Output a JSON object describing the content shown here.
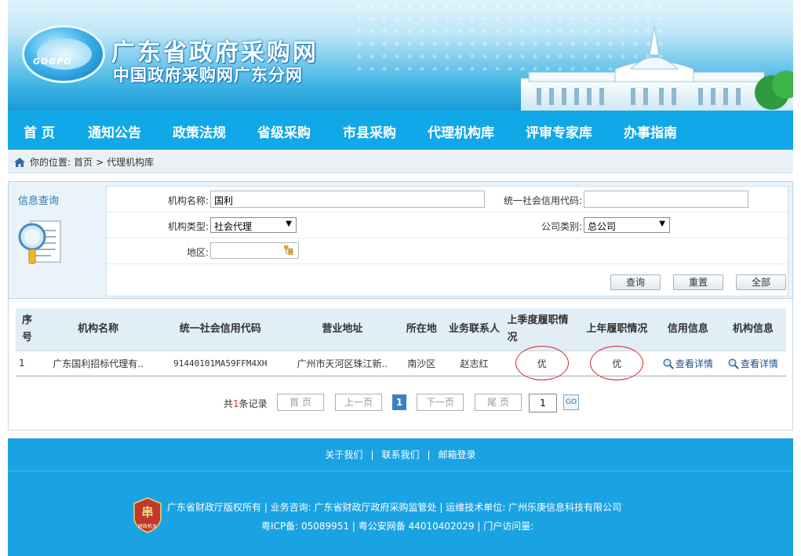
{
  "header": {
    "logo_text": "GDGPO",
    "site_title": "广东省政府采购网",
    "site_subtitle": "中国政府采购网广东分网"
  },
  "nav": {
    "items": [
      "首 页",
      "通知公告",
      "政策法规",
      "省级采购",
      "市县采购",
      "代理机构库",
      "评审专家库",
      "办事指南"
    ]
  },
  "breadcrumb": {
    "prefix": "你的位置:",
    "home": "首页",
    "separator": ">",
    "current": "代理机构库"
  },
  "query": {
    "panel_label": "信息查询",
    "org_name_label": "机构名称:",
    "org_name_value": "国利",
    "credit_code_label": "统一社会信用代码:",
    "credit_code_value": "",
    "org_type_label": "机构类型:",
    "org_type_value": "社会代理",
    "company_type_label": "公司类别:",
    "company_type_value": "总公司",
    "region_label": "地区:",
    "region_value": "",
    "search_btn": "查询",
    "reset_btn": "重置",
    "all_btn": "全部"
  },
  "table": {
    "headers": {
      "seq": "序号",
      "name": "机构名称",
      "code": "统一社会信用代码",
      "address": "营业地址",
      "location": "所在地",
      "contact": "业务联系人",
      "last_quarter": "上季度履职情况",
      "last_year": "上年履职情况",
      "credit": "信用信息",
      "org_info": "机构信息"
    },
    "rows": [
      {
        "seq": "1",
        "name": "广东国利招标代理有..",
        "code": "91440101MA59FFM4XH",
        "address": "广州市天河区珠江新..",
        "location": "南沙区",
        "contact": "赵志红",
        "last_quarter": "优",
        "last_year": "优",
        "credit": "查看详情",
        "org_info": "查看详情"
      }
    ]
  },
  "pager": {
    "total_prefix": "共",
    "total_count": "1",
    "total_suffix": "条记录",
    "first": "首 页",
    "prev": "上一页",
    "current": "1",
    "next": "下一页",
    "last": "尾 页",
    "jump_value": "1",
    "go": "GO"
  },
  "footer": {
    "links": [
      "关于我们",
      "联系我们",
      "邮箱登录"
    ],
    "line1": "广东省财政厅版权所有 | 业务咨询: 广东省财政厅政府采购监管处 | 运维技术单位: 广州乐庚信息科技有限公司",
    "line2": "粤ICP备: 05089951 | 粤公安网备 44010402029 | 门户访问量:",
    "emblem_text": "财政机关"
  },
  "colors": {
    "nav_bg": "#11a8e8",
    "footer_bg": "#1aa3e3",
    "highlight_red": "#d9282c",
    "link_blue": "#1d4f91"
  }
}
